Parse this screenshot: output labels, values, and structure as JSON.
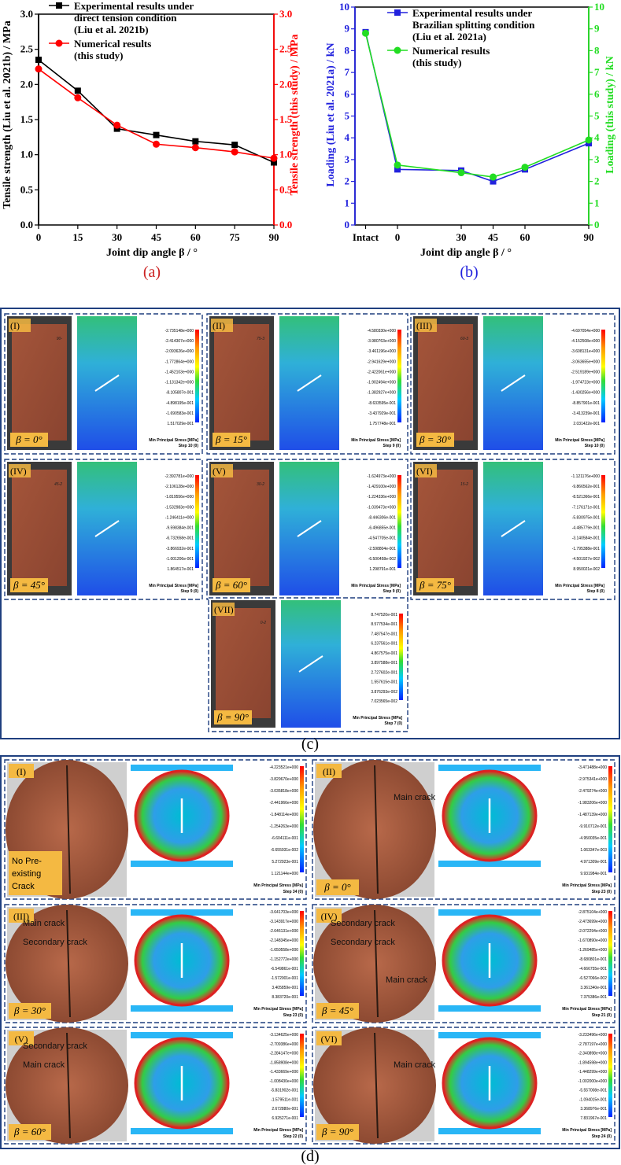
{
  "chart_data": [
    {
      "id": "a",
      "type": "line",
      "panel_label": "(a)",
      "x": [
        0,
        15,
        30,
        45,
        60,
        75,
        90
      ],
      "xlabel": "Joint dip angle β / °",
      "ylabel": "Tensile strength (Liu et al. 2021b) / MPa",
      "y2label": "Tensile strength (this study) / MPa",
      "xticks": [
        "0",
        "15",
        "30",
        "45",
        "60",
        "75",
        "90"
      ],
      "yticks": [
        "0.0",
        "0.5",
        "1.0",
        "1.5",
        "2.0",
        "2.5",
        "3.0"
      ],
      "xlim": [
        0,
        90
      ],
      "ylim": [
        0,
        3.0
      ],
      "y2lim": [
        0,
        3.0
      ],
      "series": [
        {
          "name": "Experimental results under direct tension condition (Liu et al. 2021b)",
          "legend_lines": [
            "Experimental results under",
            "direct tension condition",
            "(Liu et al. 2021b)"
          ],
          "color": "#000000",
          "marker": "square",
          "values": [
            2.35,
            1.91,
            1.37,
            1.28,
            1.19,
            1.14,
            0.89
          ]
        },
        {
          "name": "Numerical results (this study)",
          "legend_lines": [
            "Numerical results",
            "(this study)"
          ],
          "color": "#ff0000",
          "marker": "circle",
          "values": [
            2.22,
            1.81,
            1.42,
            1.15,
            1.1,
            1.04,
            0.95
          ]
        }
      ]
    },
    {
      "id": "b",
      "type": "line",
      "panel_label": "(b)",
      "categories": [
        "Intact",
        "0",
        "30",
        "45",
        "60",
        "90"
      ],
      "x": [
        -15,
        0,
        30,
        45,
        60,
        90
      ],
      "xlabel": "Joint dip angle β / °",
      "ylabel": "Loading (Liu et al. 2021a) / kN",
      "y2label": "Loading (this study) / kN",
      "yticks": [
        "0",
        "1",
        "2",
        "3",
        "4",
        "5",
        "6",
        "7",
        "8",
        "9",
        "10"
      ],
      "ylim": [
        0,
        10
      ],
      "y2lim": [
        0,
        10
      ],
      "series": [
        {
          "name": "Experimental results under Brazilian splitting condition (Liu et al. 2021a)",
          "legend_lines": [
            "Experimental results under",
            "Brazilian splitting condition",
            "(Liu et al. 2021a)"
          ],
          "color": "#2222dd",
          "marker": "square",
          "values": [
            8.85,
            2.55,
            2.5,
            2.0,
            2.55,
            3.75
          ]
        },
        {
          "name": "Numerical results (this study)",
          "legend_lines": [
            "Numerical results",
            "(this study)"
          ],
          "color": "#22dd22",
          "marker": "circle",
          "values": [
            8.8,
            2.75,
            2.4,
            2.2,
            2.65,
            3.9
          ]
        }
      ]
    }
  ],
  "panel_c": {
    "label": "(c)",
    "cells": [
      {
        "roman": "(I)",
        "beta": "β = 0°",
        "specimen": "90-",
        "legend": [
          "-2.735148e+000",
          "-2.414307e+000",
          "-2.093626e+000",
          "-1.772864e+000",
          "-1.452103e+000",
          "-1.131342e+000",
          "-8.105807e-001",
          "-4.898195e-001",
          "-1.690583e-001",
          "1.517029e-001"
        ],
        "step": "Step 10 (0)"
      },
      {
        "roman": "(II)",
        "beta": "β = 15°",
        "specimen": "75-3",
        "legend": [
          "-4.580330e+000",
          "-3.980763e+000",
          "-3.461196e+000",
          "-2.941629e+000",
          "-2.422061e+000",
          "-1.902494e+000",
          "-1.382927e+000",
          "-8.633595e-001",
          "-3.437929e-001",
          "1.757748e-001"
        ],
        "step": "Step 9 (0)"
      },
      {
        "roman": "(III)",
        "beta": "β = 30°",
        "specimen": "60-3",
        "legend": [
          "-4.697054e+000",
          "-4.152508e+000",
          "-3.608131e+000",
          "-3.063655e+000",
          "-2.519189e+000",
          "-1.974723e+000",
          "-1.430256e+000",
          "-8.857901e-001",
          "-3.413239e-001",
          "2.031422e-001"
        ],
        "step": "Step 10 (0)"
      },
      {
        "roman": "(IV)",
        "beta": "β = 45°",
        "specimen": "45-2",
        "legend": [
          "-2.392781e+000",
          "-2.106128e+000",
          "-1.819556e+000",
          "-1.532983e+000",
          "-1.246411e+000",
          "-9.598384e-001",
          "-6.732658e-001",
          "-3.866932e-001",
          "-1.001206e-001",
          "1.864517e-001"
        ],
        "step": "Step 9 (0)"
      },
      {
        "roman": "(V)",
        "beta": "β = 60°",
        "specimen": "30-2",
        "legend": [
          "-1.624973e+000",
          "-1.429100e+000",
          "-1.224336e+000",
          "-1.039473e+000",
          "-8.446306e-001",
          "-6.496855e-001",
          "-4.547705e-001",
          "-2.598804e-001",
          "-6.500458e-002",
          "1.298791e-001"
        ],
        "step": "Step 9 (0)"
      },
      {
        "roman": "(VI)",
        "beta": "β = 75°",
        "specimen": "15-2",
        "legend": [
          "-1.121176e+000",
          "-9.866562e-001",
          "-8.521366e-001",
          "-7.176171e-001",
          "-5.830975e-001",
          "-4.485779e-001",
          "-3.140584e-001",
          "-1.795388e-001",
          "-4.501927e-002",
          "8.950021e-002"
        ],
        "step": "Step 8 (0)"
      },
      {
        "roman": "(VII)",
        "beta": "β = 90°",
        "specimen": "0-2",
        "legend": [
          "8.747520e-001",
          "8.577534e-001",
          "7.487547e-001",
          "6.237561e-001",
          "4.867575e-001",
          "3.897588e-001",
          "2.727602e-001",
          "1.557615e-001",
          "3.876293e-002",
          "7.023565e-002"
        ],
        "step": "Step 7 (0)"
      }
    ],
    "legend_title": "Min Principal Stress [MPa]"
  },
  "panel_d": {
    "label": "(d)",
    "cells": [
      {
        "roman": "(I)",
        "beta": "",
        "note_lines": [
          "No Pre-",
          "existing",
          "Crack"
        ],
        "crack_labels": [],
        "legend": [
          "-4.223521e+000",
          "-3.829670e+000",
          "-3.035818e+000",
          "-2.441966e+000",
          "-1.848114e+000",
          "-1.254263e+000",
          "-6.604111e-001",
          "-6.655931e-002",
          "5.272923e-001",
          "1.121144e+000"
        ],
        "step": "Step 34 (0)"
      },
      {
        "roman": "(II)",
        "beta": "β = 0°",
        "note_lines": [],
        "crack_labels": [
          "Main crack"
        ],
        "legend": [
          "-3.471488e+000",
          "-2.975341e+000",
          "-2.479274e+000",
          "-1.983206e+000",
          "-1.487139e+000",
          "-9.910712e-001",
          "-4.950035e-001",
          "1.063347e-003",
          "4.971309e-001",
          "9.931984e-001"
        ],
        "step": "Step 23 (0)"
      },
      {
        "roman": "(III)",
        "beta": "β = 30°",
        "note_lines": [],
        "crack_labels": [
          "Secondary crack",
          "Main crack"
        ],
        "legend": [
          "-3.641703e+000",
          "-3.143917e+000",
          "-2.646131e+000",
          "-2.148345e+000",
          "-1.650558e+000",
          "-1.152772e+000",
          "-6.549861e-001",
          "-1.572001e-001",
          "3.405859e-001",
          "8.383720e-001"
        ],
        "step": "Step 23 (0)"
      },
      {
        "roman": "(IV)",
        "beta": "β = 45°",
        "note_lines": [],
        "crack_labels": [
          "Secondary crack",
          "Secondary crack",
          "Main crack"
        ],
        "legend": [
          "-2.875104e+000",
          "-2.473699e+000",
          "-2.072294e+000",
          "-1.670890e+000",
          "-1.269485e+000",
          "-8.680801e-001",
          "-4.666755e-001",
          "-6.527066e-002",
          "3.361340e-001",
          "7.375386e-001"
        ],
        "step": "Step 21 (0)"
      },
      {
        "roman": "(V)",
        "beta": "β = 60°",
        "note_lines": [],
        "crack_labels": [
          "Main crack",
          "Secondary crack"
        ],
        "legend": [
          "-3.134625e+000",
          "-2.709386e+000",
          "-2.284147e+000",
          "-1.858908e+000",
          "-1.433669e+000",
          "-1.008430e+000",
          "-5.831902e-001",
          "-1.579511e-001",
          "2.672880e-001",
          "6.925271e-001"
        ],
        "step": "Step 22 (0)"
      },
      {
        "roman": "(VI)",
        "beta": "β = 90°",
        "note_lines": [],
        "crack_labels": [
          "Main crack"
        ],
        "legend": [
          "-3.233496e+000",
          "-2.787197e+000",
          "-2.340898e+000",
          "-1.894598e+000",
          "-1.448299e+000",
          "-1.002000e+000",
          "-5.557008e-001",
          "-1.094015e-001",
          "3.368976e-001",
          "7.831967e-001"
        ],
        "step": "Step 24 (0)"
      }
    ],
    "legend_title": "Min Principal Stress [MPa]"
  }
}
